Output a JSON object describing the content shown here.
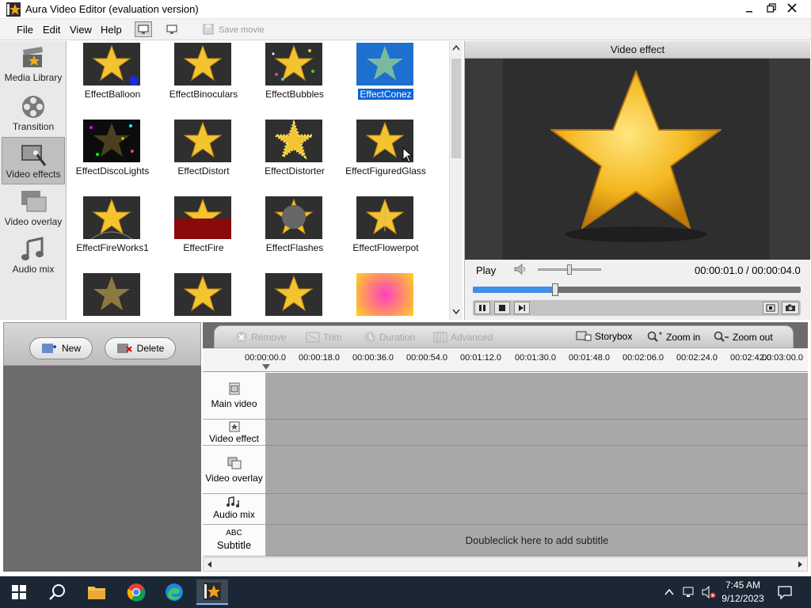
{
  "window": {
    "title": "Aura Video Editor (evaluation version)",
    "controls": {
      "minimize": "🗕",
      "maximize": "🗗",
      "close": "✕"
    }
  },
  "menu": {
    "items": [
      "File",
      "Edit",
      "View",
      "Help"
    ],
    "save_movie": "Save movie"
  },
  "sidebar": {
    "items": [
      {
        "label": "Media Library",
        "icon": "film-clapper-icon"
      },
      {
        "label": "Transition",
        "icon": "transition-reel-icon"
      },
      {
        "label": "Video effects",
        "icon": "video-effects-icon",
        "active": true
      },
      {
        "label": "Video overlay",
        "icon": "video-overlay-icon"
      },
      {
        "label": "Audio mix",
        "icon": "music-note-icon"
      }
    ]
  },
  "effects": {
    "items": [
      "EffectBalloon",
      "EffectBinoculars",
      "EffectBubbles",
      "EffectConez",
      "EffectDiscoLights",
      "EffectDistort",
      "EffectDistorter",
      "EffectFiguredGlass",
      "EffectFireWorks1",
      "EffectFire",
      "EffectFlashes",
      "EffectFlowerpot",
      "",
      "",
      "",
      ""
    ],
    "selected": "EffectConez"
  },
  "preview": {
    "header": "Video effect",
    "play_label": "Play",
    "time": "00:00:01.0 / 00:00:04.0",
    "progress": 0.25,
    "volume": 0.5
  },
  "left_panel": {
    "new_label": "New",
    "delete_label": "Delete"
  },
  "timeline": {
    "toolbar": {
      "remove": "Remove",
      "trim": "Trim",
      "duration": "Duration",
      "advanced": "Advanced",
      "storybox": "Storybox",
      "zoom_in": "Zoom in",
      "zoom_out": "Zoom out"
    },
    "ruler": [
      "00:00:00.0",
      "00:00:18.0",
      "00:00:36.0",
      "00:00:54.0",
      "00:01:12.0",
      "00:01:30.0",
      "00:01:48.0",
      "00:02:06.0",
      "00:02:24.0",
      "00:02:42.0",
      "00:03:00.0"
    ],
    "tracks": [
      {
        "label": "Main video",
        "icon": "main-video-icon"
      },
      {
        "label": "Video effect",
        "icon": "video-effect-track-icon"
      },
      {
        "label": "Video overlay",
        "icon": "video-overlay-track-icon"
      },
      {
        "label": "Audio mix",
        "icon": "audio-mix-track-icon"
      },
      {
        "label": "Subtitle",
        "icon_text": "ABC"
      }
    ],
    "subtitle_hint": "Doubleclick here to add subtitle"
  },
  "taskbar": {
    "time": "7:45 AM",
    "date": "9/12/2023"
  }
}
